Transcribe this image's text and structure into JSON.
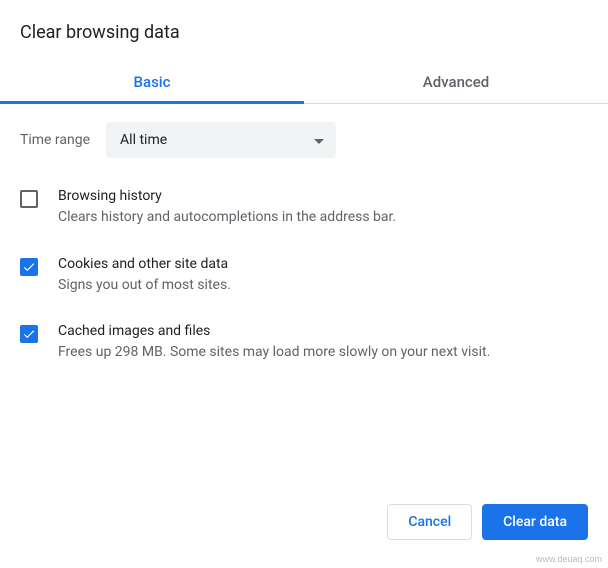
{
  "dialog": {
    "title": "Clear browsing data"
  },
  "tabs": {
    "basic": "Basic",
    "advanced": "Advanced"
  },
  "timeRange": {
    "label": "Time range",
    "selected": "All time"
  },
  "options": [
    {
      "title": "Browsing history",
      "desc": "Clears history and autocompletions in the address bar.",
      "checked": false
    },
    {
      "title": "Cookies and other site data",
      "desc": "Signs you out of most sites.",
      "checked": true
    },
    {
      "title": "Cached images and files",
      "desc": "Frees up 298 MB. Some sites may load more slowly on your next visit.",
      "checked": true
    }
  ],
  "buttons": {
    "cancel": "Cancel",
    "clear": "Clear data"
  },
  "watermark": "www.deuaq.com"
}
